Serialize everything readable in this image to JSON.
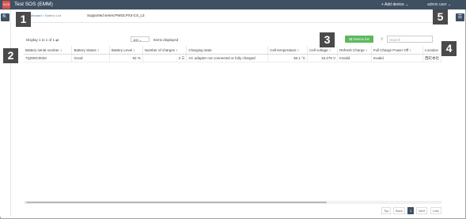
{
  "header": {
    "logo_text": "SOS",
    "app_title": "Test SOS (EMM)",
    "add_device": "+ Add device ⌄",
    "user_menu": "admin user ⌄"
  },
  "breadcrumb": {
    "home": "Dashboard",
    "separator": " > ",
    "current": "Battery List"
  },
  "supported_series": "Supported series:PW03,PX3-CS_L3",
  "toolbar": {
    "display_info": "Display 1 to 1 of 1 ⇄",
    "per_page_value": "100 ⌄",
    "per_page_label": "Items displayed",
    "device_list_label": "⊞ Device list",
    "search_placeholder": "Search"
  },
  "table": {
    "columns": [
      "Battery serial number ↕",
      "Battery Status ↕",
      "Battery Level ↕",
      "Number of charges ↕",
      "Charging state",
      "Cell temperature ↕",
      "Cell voltage ↕",
      "Refresh Charge ↕",
      "Full Charge Power Off ↕",
      "Location"
    ],
    "rows": [
      [
        "7Q000C0033",
        "Good",
        "92 %",
        "2 ☰",
        "AC adapter not connected or fully charged",
        "36.1 °C",
        "16.275 V",
        "Invalid",
        "Invalid",
        "西町本社"
      ]
    ]
  },
  "pagination": {
    "top": "Top",
    "back": "Back",
    "current": "1",
    "next": "Next",
    "last": "Last"
  },
  "side": {
    "search_btn": "🔍",
    "menu_btn": "☰"
  },
  "callouts": [
    "1",
    "2",
    "3",
    "4",
    "5"
  ],
  "colors": {
    "topbar": "#3f5063",
    "accent_green": "#5cb85c",
    "callout_bg": "#4a4a4a"
  }
}
